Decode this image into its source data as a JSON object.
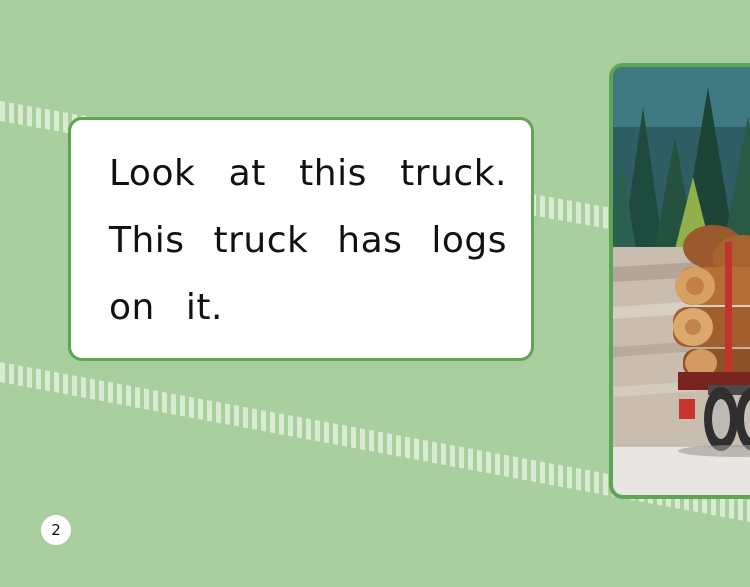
{
  "page": {
    "lines": [
      "Look at this truck.",
      "This truck has logs",
      "on it."
    ],
    "page_number": "2"
  },
  "colors": {
    "background": "#a9cf9f",
    "frame_border": "#5ea555",
    "track": "#dcecd6"
  },
  "photo": {
    "subject": "logging truck loaded with logs"
  }
}
